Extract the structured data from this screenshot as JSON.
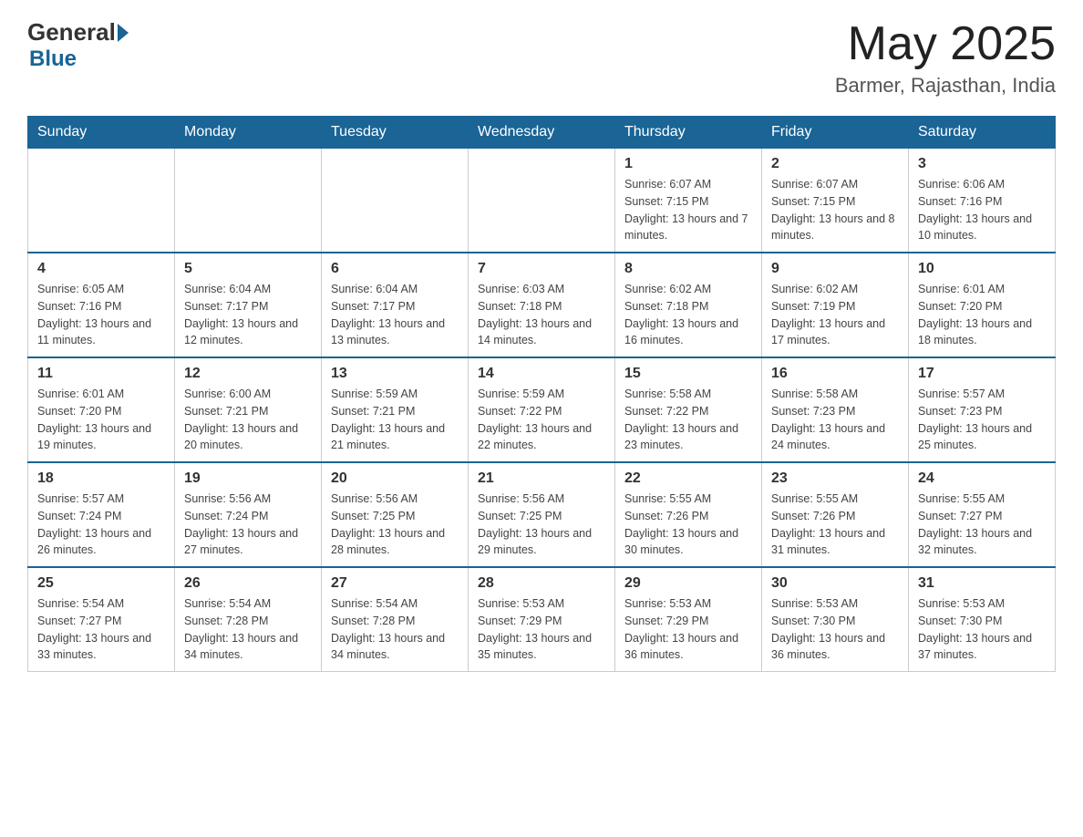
{
  "header": {
    "logo_general": "General",
    "logo_blue": "Blue",
    "month_year": "May 2025",
    "location": "Barmer, Rajasthan, India"
  },
  "days_of_week": [
    "Sunday",
    "Monday",
    "Tuesday",
    "Wednesday",
    "Thursday",
    "Friday",
    "Saturday"
  ],
  "weeks": [
    {
      "days": [
        {
          "num": "",
          "info": ""
        },
        {
          "num": "",
          "info": ""
        },
        {
          "num": "",
          "info": ""
        },
        {
          "num": "",
          "info": ""
        },
        {
          "num": "1",
          "info": "Sunrise: 6:07 AM\nSunset: 7:15 PM\nDaylight: 13 hours and 7 minutes."
        },
        {
          "num": "2",
          "info": "Sunrise: 6:07 AM\nSunset: 7:15 PM\nDaylight: 13 hours and 8 minutes."
        },
        {
          "num": "3",
          "info": "Sunrise: 6:06 AM\nSunset: 7:16 PM\nDaylight: 13 hours and 10 minutes."
        }
      ]
    },
    {
      "days": [
        {
          "num": "4",
          "info": "Sunrise: 6:05 AM\nSunset: 7:16 PM\nDaylight: 13 hours and 11 minutes."
        },
        {
          "num": "5",
          "info": "Sunrise: 6:04 AM\nSunset: 7:17 PM\nDaylight: 13 hours and 12 minutes."
        },
        {
          "num": "6",
          "info": "Sunrise: 6:04 AM\nSunset: 7:17 PM\nDaylight: 13 hours and 13 minutes."
        },
        {
          "num": "7",
          "info": "Sunrise: 6:03 AM\nSunset: 7:18 PM\nDaylight: 13 hours and 14 minutes."
        },
        {
          "num": "8",
          "info": "Sunrise: 6:02 AM\nSunset: 7:18 PM\nDaylight: 13 hours and 16 minutes."
        },
        {
          "num": "9",
          "info": "Sunrise: 6:02 AM\nSunset: 7:19 PM\nDaylight: 13 hours and 17 minutes."
        },
        {
          "num": "10",
          "info": "Sunrise: 6:01 AM\nSunset: 7:20 PM\nDaylight: 13 hours and 18 minutes."
        }
      ]
    },
    {
      "days": [
        {
          "num": "11",
          "info": "Sunrise: 6:01 AM\nSunset: 7:20 PM\nDaylight: 13 hours and 19 minutes."
        },
        {
          "num": "12",
          "info": "Sunrise: 6:00 AM\nSunset: 7:21 PM\nDaylight: 13 hours and 20 minutes."
        },
        {
          "num": "13",
          "info": "Sunrise: 5:59 AM\nSunset: 7:21 PM\nDaylight: 13 hours and 21 minutes."
        },
        {
          "num": "14",
          "info": "Sunrise: 5:59 AM\nSunset: 7:22 PM\nDaylight: 13 hours and 22 minutes."
        },
        {
          "num": "15",
          "info": "Sunrise: 5:58 AM\nSunset: 7:22 PM\nDaylight: 13 hours and 23 minutes."
        },
        {
          "num": "16",
          "info": "Sunrise: 5:58 AM\nSunset: 7:23 PM\nDaylight: 13 hours and 24 minutes."
        },
        {
          "num": "17",
          "info": "Sunrise: 5:57 AM\nSunset: 7:23 PM\nDaylight: 13 hours and 25 minutes."
        }
      ]
    },
    {
      "days": [
        {
          "num": "18",
          "info": "Sunrise: 5:57 AM\nSunset: 7:24 PM\nDaylight: 13 hours and 26 minutes."
        },
        {
          "num": "19",
          "info": "Sunrise: 5:56 AM\nSunset: 7:24 PM\nDaylight: 13 hours and 27 minutes."
        },
        {
          "num": "20",
          "info": "Sunrise: 5:56 AM\nSunset: 7:25 PM\nDaylight: 13 hours and 28 minutes."
        },
        {
          "num": "21",
          "info": "Sunrise: 5:56 AM\nSunset: 7:25 PM\nDaylight: 13 hours and 29 minutes."
        },
        {
          "num": "22",
          "info": "Sunrise: 5:55 AM\nSunset: 7:26 PM\nDaylight: 13 hours and 30 minutes."
        },
        {
          "num": "23",
          "info": "Sunrise: 5:55 AM\nSunset: 7:26 PM\nDaylight: 13 hours and 31 minutes."
        },
        {
          "num": "24",
          "info": "Sunrise: 5:55 AM\nSunset: 7:27 PM\nDaylight: 13 hours and 32 minutes."
        }
      ]
    },
    {
      "days": [
        {
          "num": "25",
          "info": "Sunrise: 5:54 AM\nSunset: 7:27 PM\nDaylight: 13 hours and 33 minutes."
        },
        {
          "num": "26",
          "info": "Sunrise: 5:54 AM\nSunset: 7:28 PM\nDaylight: 13 hours and 34 minutes."
        },
        {
          "num": "27",
          "info": "Sunrise: 5:54 AM\nSunset: 7:28 PM\nDaylight: 13 hours and 34 minutes."
        },
        {
          "num": "28",
          "info": "Sunrise: 5:53 AM\nSunset: 7:29 PM\nDaylight: 13 hours and 35 minutes."
        },
        {
          "num": "29",
          "info": "Sunrise: 5:53 AM\nSunset: 7:29 PM\nDaylight: 13 hours and 36 minutes."
        },
        {
          "num": "30",
          "info": "Sunrise: 5:53 AM\nSunset: 7:30 PM\nDaylight: 13 hours and 36 minutes."
        },
        {
          "num": "31",
          "info": "Sunrise: 5:53 AM\nSunset: 7:30 PM\nDaylight: 13 hours and 37 minutes."
        }
      ]
    }
  ]
}
